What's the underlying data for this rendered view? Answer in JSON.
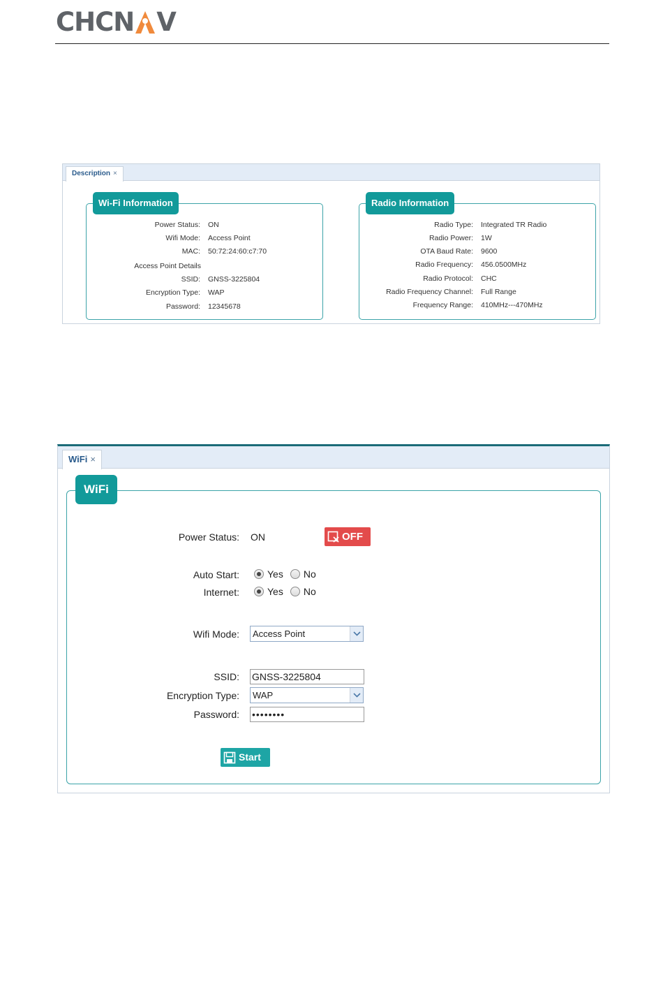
{
  "header": {
    "brand_part1": "CHCN",
    "brand_part2": "V"
  },
  "description_panel": {
    "tab_label": "Description",
    "tab_close": "×",
    "wifi_info": {
      "title": "Wi-Fi Information",
      "rows": [
        {
          "label": "Power Status:",
          "value": "ON"
        },
        {
          "label": "Wifi Mode:",
          "value": "Access Point"
        },
        {
          "label": "MAC:",
          "value": "50:72:24:60:c7:70"
        },
        {
          "label": "Access Point Details",
          "value": ""
        },
        {
          "label": "SSID:",
          "value": "GNSS-3225804"
        },
        {
          "label": "Encryption Type:",
          "value": "WAP"
        },
        {
          "label": "Password:",
          "value": "12345678"
        }
      ]
    },
    "radio_info": {
      "title": "Radio Information",
      "rows": [
        {
          "label": "Radio Type:",
          "value": "Integrated TR Radio"
        },
        {
          "label": "Radio Power:",
          "value": "1W"
        },
        {
          "label": "OTA Baud Rate:",
          "value": "9600"
        },
        {
          "label": "Radio Frequency:",
          "value": "456.0500MHz"
        },
        {
          "label": "Radio Protocol:",
          "value": "CHC"
        },
        {
          "label": "Radio Frequency Channel:",
          "value": "Full Range"
        },
        {
          "label": "Frequency Range:",
          "value": "410MHz---470MHz"
        }
      ]
    }
  },
  "wifi_panel": {
    "tab_label": "WiFi",
    "tab_close": "×",
    "title": "WiFi",
    "power_status_label": "Power Status:",
    "power_status_value": "ON",
    "off_button_label": "OFF",
    "auto_start_label": "Auto Start:",
    "internet_label": "Internet:",
    "yes_label": "Yes",
    "no_label": "No",
    "auto_start_selected": "Yes",
    "internet_selected": "Yes",
    "wifi_mode_label": "Wifi Mode:",
    "wifi_mode_value": "Access Point",
    "ssid_label": "SSID:",
    "ssid_value": "GNSS-3225804",
    "encryption_label": "Encryption Type:",
    "encryption_value": "WAP",
    "password_label": "Password:",
    "password_value": "••••••••",
    "start_button_label": "Start"
  },
  "colors": {
    "teal": "#129a9a",
    "logo_orange": "#f08a3c",
    "off_red": "#e34b4b",
    "tab_bar": "#e3ecf7"
  }
}
